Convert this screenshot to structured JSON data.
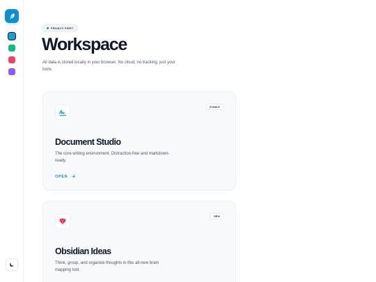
{
  "sidebar": {
    "logo_icon": "feather-icon",
    "swatches": [
      {
        "name": "blue",
        "color": "#1aa0d8",
        "active": true
      },
      {
        "name": "green",
        "color": "#12b886",
        "active": false
      },
      {
        "name": "red",
        "color": "#ef4565",
        "active": false
      },
      {
        "name": "purple",
        "color": "#8b5cf6",
        "active": false
      }
    ],
    "theme_icon": "moon-icon"
  },
  "header": {
    "badge": "PRIVACY FIRST",
    "title": "Workspace",
    "subtitle": "All data is stored locally in your browser. No cloud, no tracking, just your tools."
  },
  "cards": [
    {
      "icon": "signature-icon",
      "tag": "STABLE",
      "title": "Document Studio",
      "description": "The core writing environment. Distraction-free and markdown-ready.",
      "link_label": "OPEN",
      "link_icon": "arrow-right-icon"
    },
    {
      "icon": "gem-icon",
      "tag": "NEW",
      "title": "Obsidian Ideas",
      "description": "Think, group, and organize thoughts in this all-new brain mapping tool."
    }
  ],
  "colors": {
    "accent": "#0f8fcf",
    "gem": "#e11d48"
  }
}
